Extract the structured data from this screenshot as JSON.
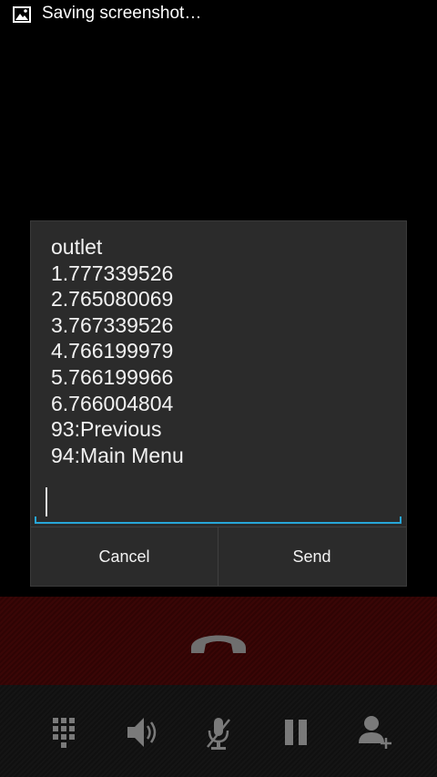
{
  "status_bar": {
    "notification_icon": "image-icon",
    "text": "Saving screenshot…"
  },
  "dialog": {
    "message_lines": [
      "outlet",
      "1.777339526",
      "2.765080069",
      "3.767339526",
      "4.766199979",
      "5.766199966",
      "6.766004804",
      "93:Previous",
      "94:Main Menu"
    ],
    "input": {
      "value": "",
      "accent_color": "#27a6d8"
    },
    "buttons": {
      "cancel": "Cancel",
      "send": "Send"
    }
  },
  "call_controls": {
    "end_call_icon": "phone-hangup-icon",
    "end_call_bg": "#3a0606",
    "controls": [
      "dialpad-icon",
      "speaker-icon",
      "mute-icon",
      "hold-icon",
      "add-call-icon"
    ]
  }
}
